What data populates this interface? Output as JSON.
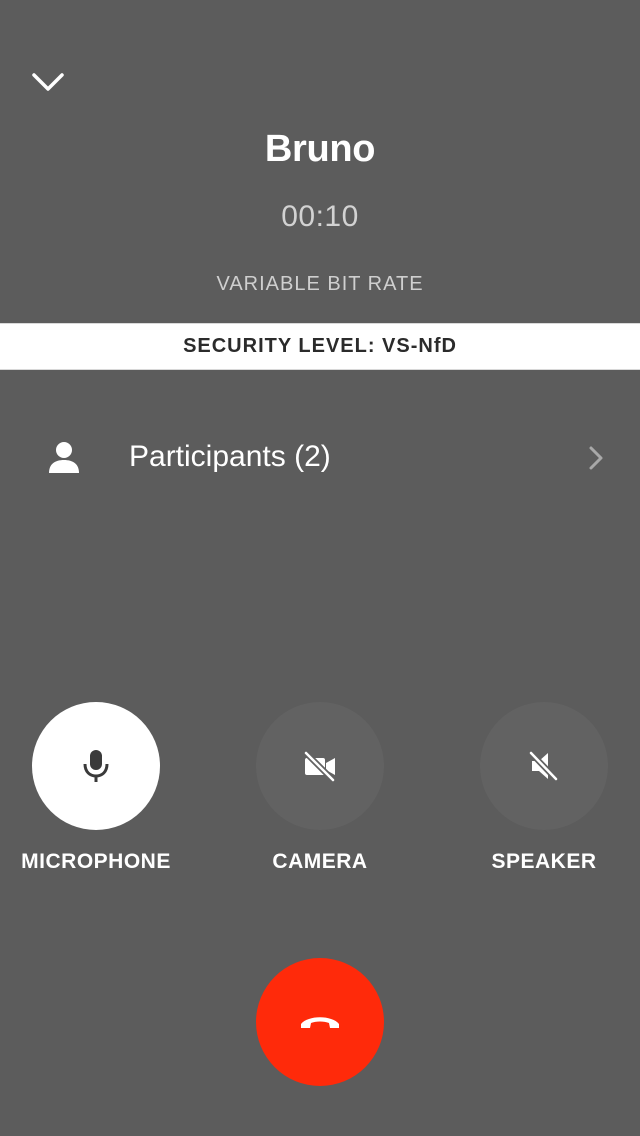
{
  "call": {
    "caller_name": "Bruno",
    "timer": "00:10",
    "bit_rate": "VARIABLE BIT RATE",
    "security_level": "SECURITY LEVEL: VS-NfD"
  },
  "participants": {
    "label": "Participants (2)",
    "icon": "person-icon"
  },
  "controls": [
    {
      "label": "MICROPHONE",
      "icon": "microphone-icon",
      "active": true
    },
    {
      "label": "CAMERA",
      "icon": "camera-off-icon",
      "active": false
    },
    {
      "label": "SPEAKER",
      "icon": "speaker-off-icon",
      "active": false
    }
  ],
  "hangup": {
    "icon": "phone-hangup-icon",
    "color": "#ff2a0a"
  },
  "colors": {
    "background": "#5c5c5c",
    "banner_background": "#ffffff",
    "banner_text": "#2b2b2b",
    "hangup": "#ff2a0a"
  }
}
